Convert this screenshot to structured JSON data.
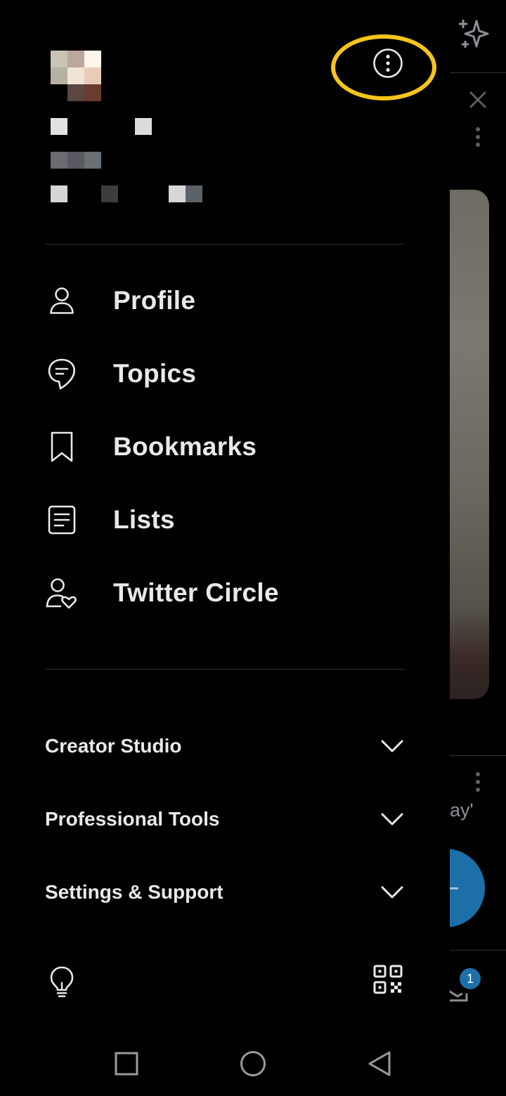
{
  "drawer": {
    "nav_items": [
      {
        "label": "Profile",
        "icon": "person-icon"
      },
      {
        "label": "Topics",
        "icon": "topics-icon"
      },
      {
        "label": "Bookmarks",
        "icon": "bookmark-icon"
      },
      {
        "label": "Lists",
        "icon": "lists-icon"
      },
      {
        "label": "Twitter Circle",
        "icon": "circle-icon"
      }
    ],
    "sections": [
      {
        "label": "Creator Studio",
        "icon": "chevron-down-icon"
      },
      {
        "label": "Professional Tools",
        "icon": "chevron-down-icon"
      },
      {
        "label": "Settings & Support",
        "icon": "chevron-down-icon"
      }
    ],
    "footer_icons": [
      "lightbulb-icon",
      "qr-code-icon"
    ],
    "header_icons": [
      "more-options-icon"
    ]
  },
  "feed": {
    "snippet": "ay'",
    "badge_count": "1"
  },
  "colors": {
    "background": "#000000",
    "text": "#e7e9ea",
    "divider": "#2f3336",
    "accent": "#1d6fa8",
    "highlight": "#f5c51a"
  }
}
